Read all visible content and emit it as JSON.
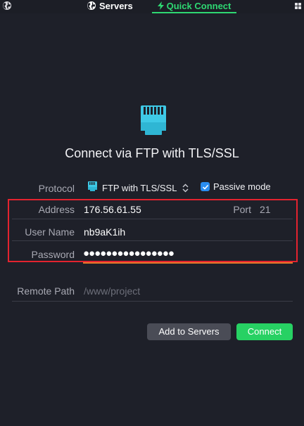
{
  "tabs": {
    "servers": "Servers",
    "quick_connect": "Quick Connect"
  },
  "heading": "Connect via FTP with TLS/SSL",
  "form": {
    "protocol_label": "Protocol",
    "protocol_value": "FTP with TLS/SSL",
    "passive_mode_label": "Passive mode",
    "passive_mode_checked": true,
    "address_label": "Address",
    "address_value": "176.56.61.55",
    "port_label": "Port",
    "port_value": "21",
    "username_label": "User Name",
    "username_value": "nb9aK1ih",
    "password_label": "Password",
    "password_value": "●●●●●●●●●●●●●●●●",
    "remote_path_label": "Remote Path",
    "remote_path_placeholder": "/www/project"
  },
  "buttons": {
    "add_to_servers": "Add to Servers",
    "connect": "Connect"
  },
  "colors": {
    "background": "#1e2029",
    "accent_green": "#2ed872",
    "highlight_red": "#e4232f",
    "checkbox_blue": "#2a8df0",
    "icon_cyan": "#3ec9e6"
  },
  "icons": {
    "top_left": "globe-icon",
    "servers_tab": "globe-icon",
    "quick_connect_tab": "lightning-icon",
    "top_right": "grid-icon",
    "protocol": "ethernet-port-icon"
  }
}
